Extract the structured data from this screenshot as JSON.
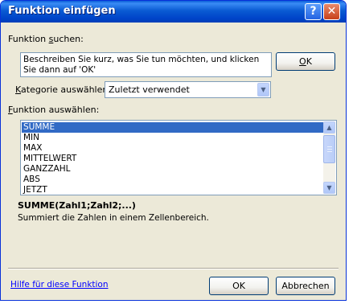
{
  "window": {
    "title": "Funktion einfügen",
    "help_button": "?",
    "close_button": "✕"
  },
  "search": {
    "label_prefix": "Funktion ",
    "label_accel": "s",
    "label_suffix": "uchen:",
    "description": "Beschreiben Sie kurz, was Sie tun möchten, und klicken Sie dann auf 'OK'",
    "ok_accel": "O",
    "ok_rest": "K"
  },
  "category": {
    "label_accel": "K",
    "label_rest": "ategorie auswählen:",
    "selected": "Zuletzt verwendet"
  },
  "functions": {
    "label_accel": "F",
    "label_rest": "unktion auswählen:",
    "items": [
      "SUMME",
      "MIN",
      "MAX",
      "MITTELWERT",
      "GANZZAHL",
      "ABS",
      "JETZT"
    ],
    "selected_index": 0
  },
  "details": {
    "signature": "SUMME(Zahl1;Zahl2;...)",
    "description": "Summiert die Zahlen in einem Zellenbereich."
  },
  "footer": {
    "help_link": "Hilfe für diese Funktion",
    "ok": "OK",
    "cancel": "Abbrechen"
  }
}
